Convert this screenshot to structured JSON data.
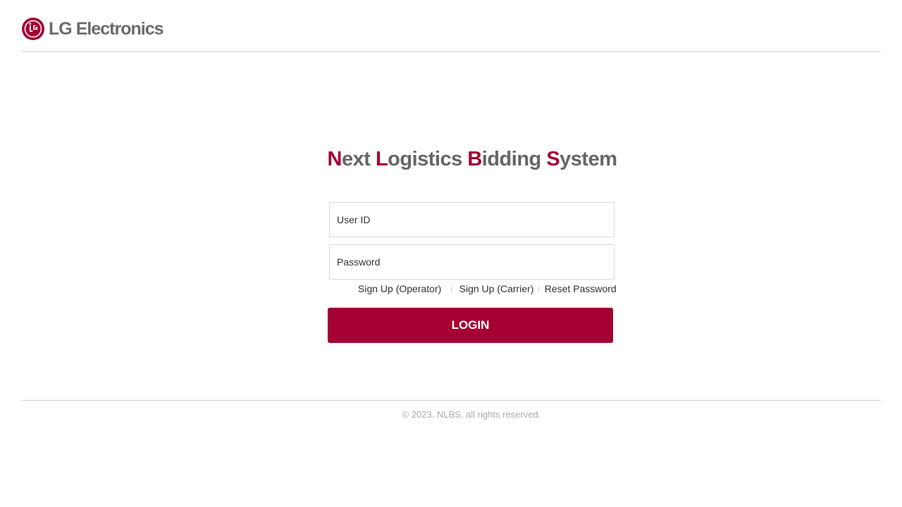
{
  "header": {
    "logo_lg": "LG",
    "logo_electronics": "Electronics",
    "brand_color": "#a50034",
    "logo_icon": "lg-face-icon"
  },
  "title": {
    "parts": [
      {
        "accent": "N",
        "rest": "ext "
      },
      {
        "accent": "L",
        "rest": "ogistics "
      },
      {
        "accent": "B",
        "rest": "idding "
      },
      {
        "accent": "S",
        "rest": "ystem"
      }
    ]
  },
  "login_form": {
    "user_id_placeholder": "User ID",
    "password_placeholder": "Password",
    "user_id_value": "",
    "password_value": ""
  },
  "links": {
    "signup_operator": "Sign Up (Operator)",
    "signup_carrier": "Sign Up (Carrier)",
    "reset_password": "Reset Password",
    "separator": "|"
  },
  "login_button": {
    "label": "LOGIN"
  },
  "footer": {
    "copyright": "© 2023. NLBS. all rights reserved."
  }
}
